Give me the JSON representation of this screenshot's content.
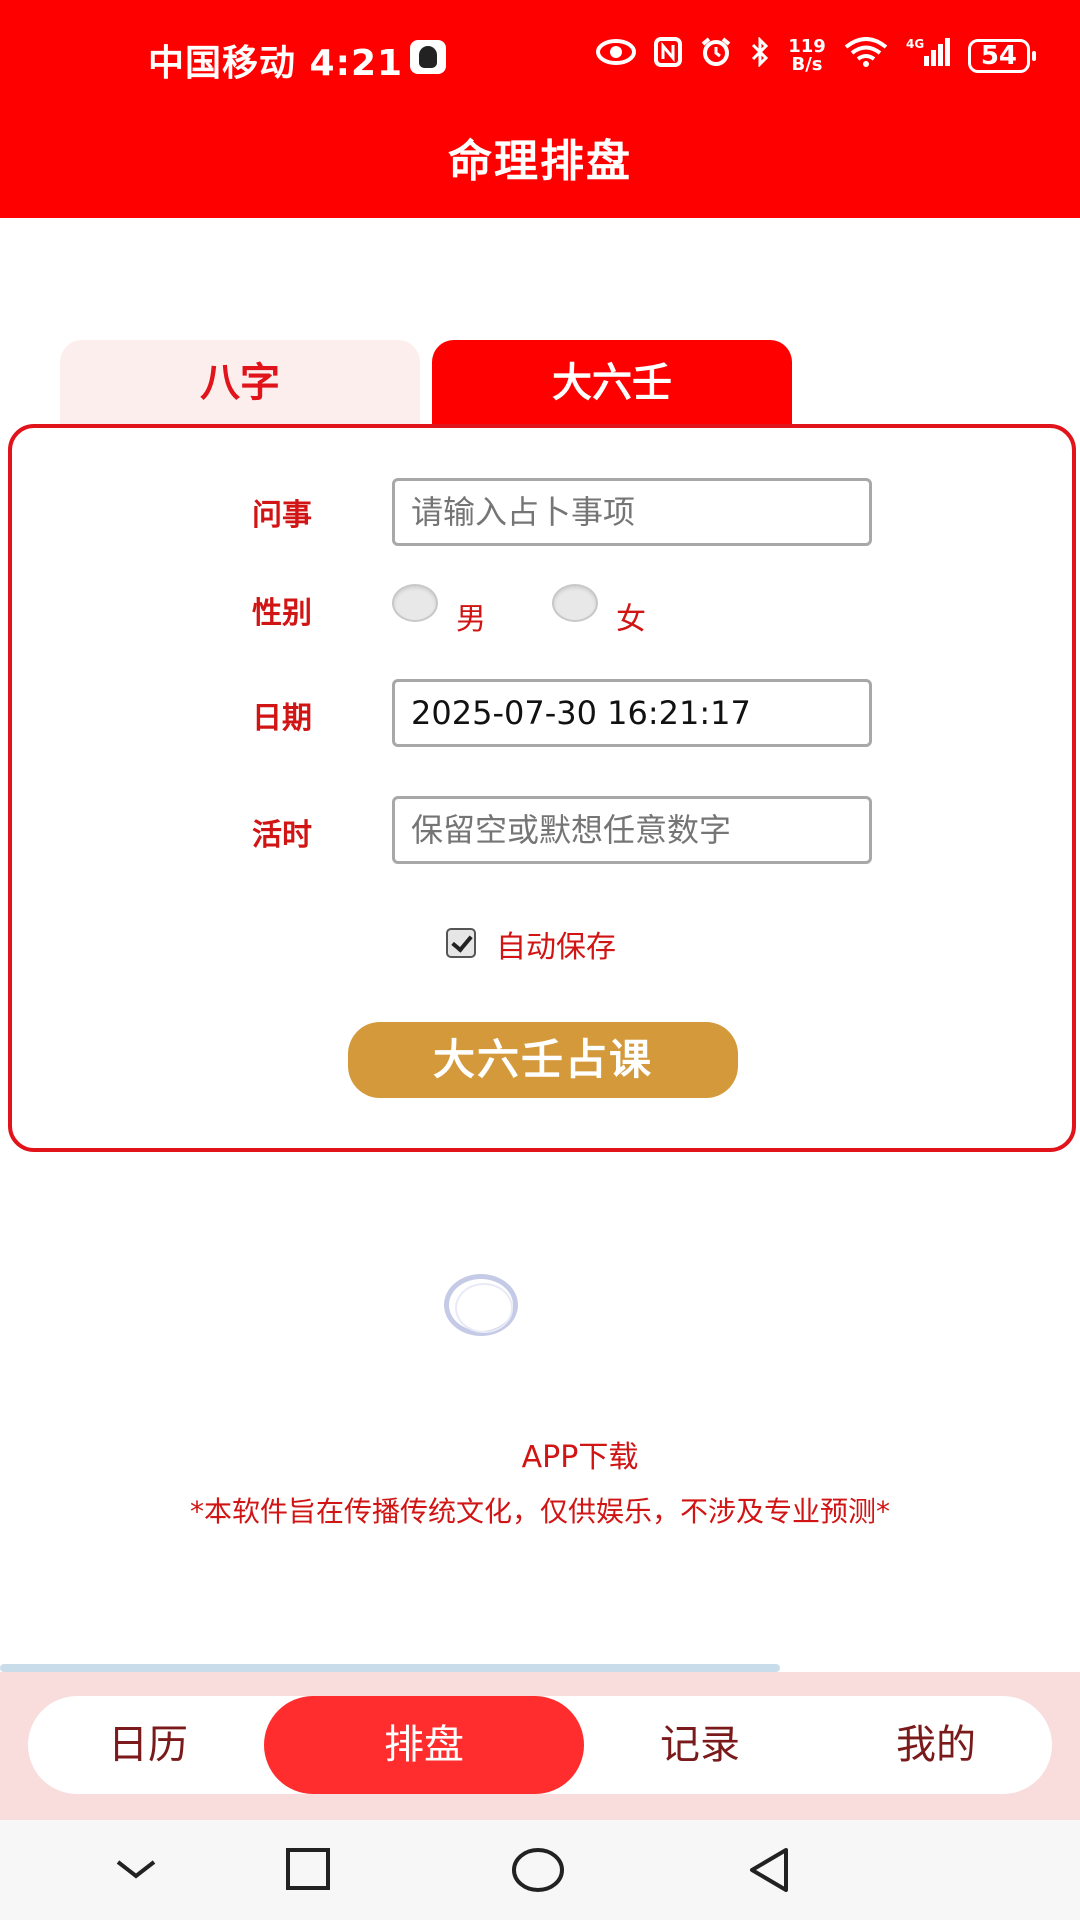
{
  "status_bar": {
    "carrier_time": "中国移动 4:21",
    "net_speed_value": "119",
    "net_speed_unit": "B/s",
    "network": "4G",
    "battery": "54"
  },
  "header": {
    "title": "命理排盘"
  },
  "tabs": [
    {
      "label": "八字",
      "active": false
    },
    {
      "label": "大六壬",
      "active": true
    }
  ],
  "form": {
    "question": {
      "label": "问事",
      "placeholder": "请输入占卜事项"
    },
    "gender": {
      "label": "性别",
      "options": [
        "男",
        "女"
      ]
    },
    "date": {
      "label": "日期",
      "value": "2025-07-30 16:21:17"
    },
    "live_time": {
      "label": "活时",
      "placeholder": "保留空或默想任意数字"
    },
    "autosave": {
      "label": "自动保存",
      "checked": true
    },
    "submit_label": "大六壬占课"
  },
  "footer": {
    "download": "APP下载",
    "disclaimer": "*本软件旨在传播传统文化，仅供娱乐，不涉及专业预测*"
  },
  "bottom_nav": [
    {
      "label": "日历",
      "active": false
    },
    {
      "label": "排盘",
      "active": true
    },
    {
      "label": "记录",
      "active": false
    },
    {
      "label": "我的",
      "active": false
    }
  ],
  "colors": {
    "primary": "#ff0000",
    "accent_button": "#d4993b",
    "text_red": "#d11414"
  }
}
